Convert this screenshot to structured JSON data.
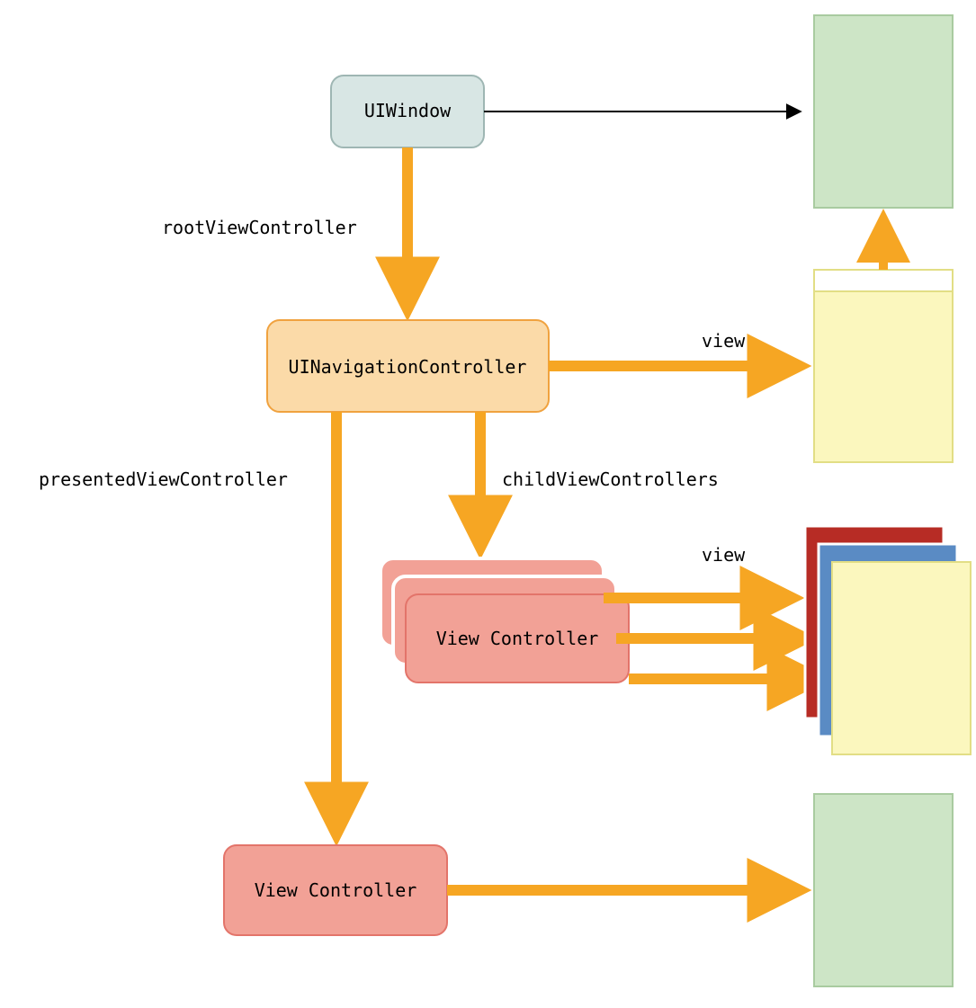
{
  "nodes": {
    "uiwindow": {
      "label": "UIWindow"
    },
    "navcontroller": {
      "label": "UINavigationController"
    },
    "childvc": {
      "label": "View Controller"
    },
    "presentedvc": {
      "label": "View Controller"
    }
  },
  "edges": {
    "root": {
      "label": "rootViewController"
    },
    "view_nav": {
      "label": "view"
    },
    "children": {
      "label": "childViewControllers"
    },
    "view_child": {
      "label": "view"
    },
    "presented": {
      "label": "presentedViewController"
    }
  },
  "colors": {
    "uiwindow_fill": "#d8e6e4",
    "uiwindow_stroke": "#9eb6b3",
    "nav_fill": "#fbdaa8",
    "nav_stroke": "#f0a23f",
    "vc_fill": "#f2a196",
    "vc_stroke": "#e3746a",
    "arrow_orange": "#f6a623",
    "arrow_black": "#000000",
    "screen_green": "#cde5c6",
    "screen_green_stroke": "#a9cba0",
    "screen_yellow": "#fbf7be",
    "screen_yellow_stroke": "#e2de85",
    "screen_red": "#b72c25",
    "screen_blue": "#5a8bc4"
  }
}
